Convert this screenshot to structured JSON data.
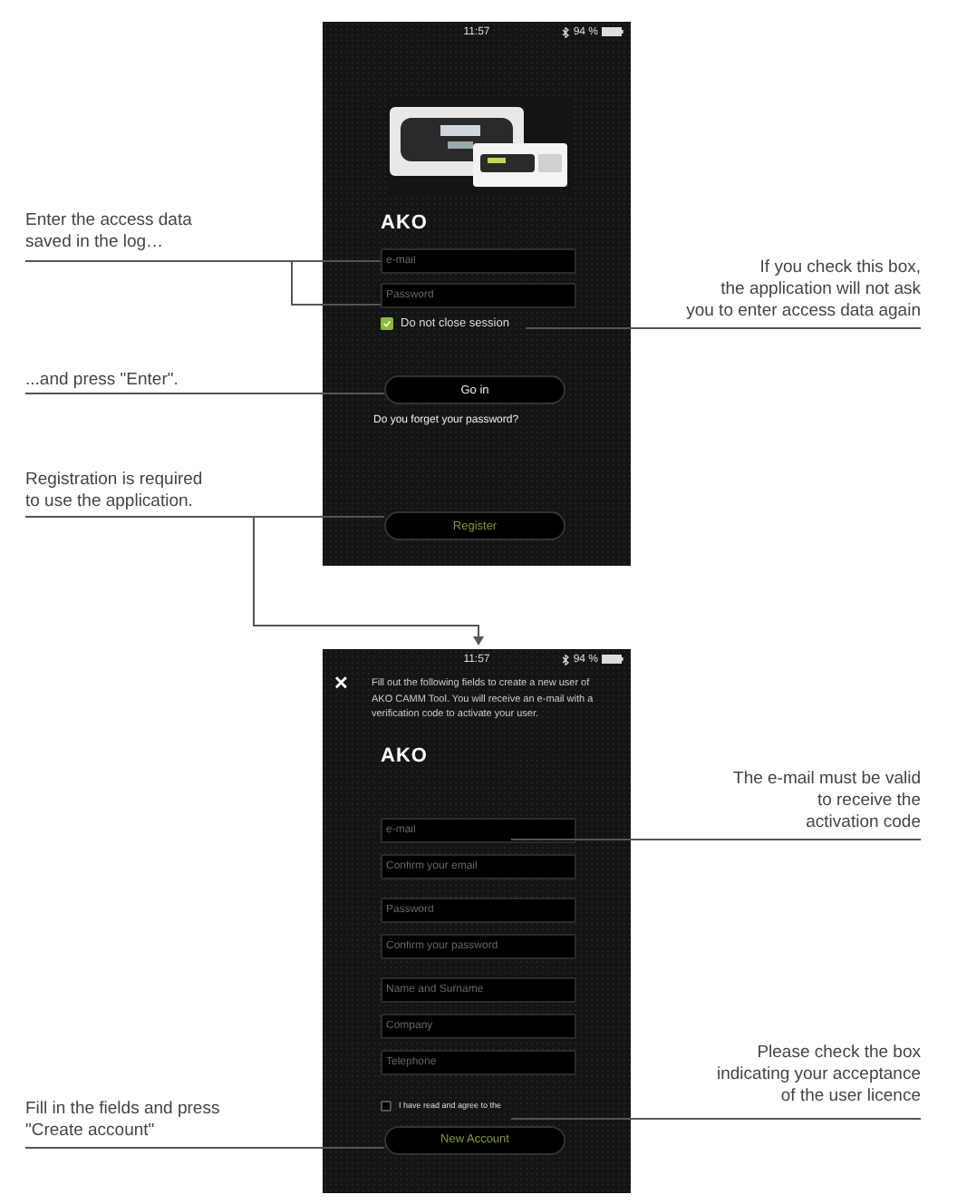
{
  "login_screen": {
    "status_bar": {
      "time": "11:57",
      "battery": "94 %"
    },
    "logo": "AKO",
    "fields": [
      {
        "placeholder": "e-mail"
      },
      {
        "placeholder": "Password"
      }
    ],
    "remember": {
      "label": "Do not close session",
      "checked": true
    },
    "buttons": [
      {
        "kind": "primary",
        "label": "Go in"
      },
      {
        "kind": "link",
        "label": "Do you forget your password?"
      },
      {
        "kind": "accent",
        "label": "Register"
      }
    ]
  },
  "register_screen": {
    "status_bar": {
      "time": "11:57",
      "battery": "94 %"
    },
    "close": "✕",
    "intro": "Fill out the following fields to create a new user of AKO CAMM Tool. You will receive an e-mail with a verification code to activate your user.",
    "logo": "AKO",
    "fields": [
      {
        "placeholder": "e-mail"
      },
      {
        "placeholder": "Confirm your email"
      },
      {
        "placeholder": "Password"
      },
      {
        "placeholder": "Confirm your password"
      },
      {
        "placeholder": "Name and Surname"
      },
      {
        "placeholder": "Company"
      },
      {
        "placeholder": "Telephone"
      }
    ],
    "agree": {
      "label": "I have read and agree to the",
      "checked": false
    },
    "buttons": [
      {
        "kind": "accent",
        "label": "New Account"
      }
    ]
  },
  "annotations": [
    {
      "kind": "left",
      "lines": [
        "Enter the access data",
        "saved in the log…"
      ]
    },
    {
      "kind": "right",
      "lines": [
        "If you check this box,",
        "the application will not ask",
        "you to enter access data again"
      ]
    },
    {
      "kind": "left",
      "lines": [
        "...and press \"Enter\"."
      ]
    },
    {
      "kind": "left",
      "lines": [
        "Registration is required",
        "to use the application."
      ]
    },
    {
      "kind": "right",
      "lines": [
        "The e-mail must be valid",
        "to receive the",
        "activation code"
      ]
    },
    {
      "kind": "right",
      "lines": [
        "Please check the box",
        "indicating your acceptance",
        "of the user licence"
      ]
    },
    {
      "kind": "left",
      "lines": [
        "Fill in the fields and press",
        "\"Create account\""
      ]
    }
  ]
}
